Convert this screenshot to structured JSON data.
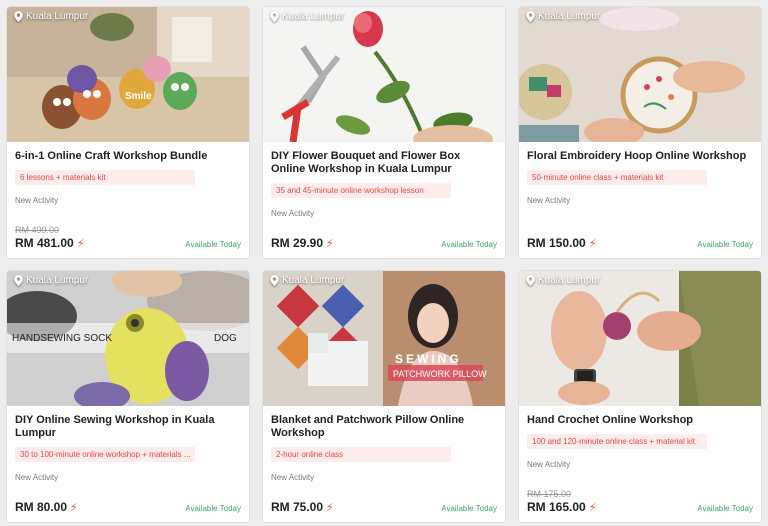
{
  "cards": [
    {
      "location": "Kuala Lumpur",
      "title": "6-in-1 Online Craft Workshop Bundle",
      "tag": "6 lessons + materials kit",
      "status": "New Activity",
      "old_price": "RM 499.00",
      "price": "RM 481.00",
      "availability": "Available Today",
      "image_text": [
        "Smile"
      ]
    },
    {
      "location": "Kuala Lumpur",
      "title": "DIY Flower Bouquet and Flower Box Online Workshop in Kuala Lumpur",
      "tag": "35 and 45-minute online workshop lesson",
      "status": "New Activity",
      "old_price": "",
      "price": "RM 29.90",
      "availability": "Available Today"
    },
    {
      "location": "Kuala Lumpur",
      "title": "Floral Embroidery Hoop Online Workshop",
      "tag": "50-minute online class + materials kit",
      "status": "New Activity",
      "old_price": "",
      "price": "RM 150.00",
      "availability": "Available Today"
    },
    {
      "location": "Kuala Lumpur",
      "title": "DIY Online Sewing Workshop in Kuala Lumpur",
      "tag": "30 to 100-minute online workshop + materials ...",
      "status": "New Activity",
      "old_price": "",
      "price": "RM 80.00",
      "availability": "Available Today",
      "image_text": [
        "HANDSEWING SOCK",
        "DOG"
      ]
    },
    {
      "location": "Kuala Lumpur",
      "title": "Blanket and Patchwork Pillow Online Workshop",
      "tag": "2-hour online class",
      "status": "New Activity",
      "old_price": "",
      "price": "RM 75.00",
      "availability": "Available Today",
      "image_text": [
        "SEWING",
        "PATCHWORK PILLOW"
      ]
    },
    {
      "location": "Kuala Lumpur",
      "title": "Hand Crochet Online Workshop",
      "tag": "100 and 120-minute online class + material kit",
      "status": "New Activity",
      "old_price": "RM 175.00",
      "price": "RM 165.00",
      "availability": "Available Today"
    }
  ],
  "icons": {
    "location": "map-pin-icon",
    "instant": "lightning-bolt-icon"
  },
  "colors": {
    "tag_bg": "#fdecec",
    "tag_text": "#e24a4a",
    "available": "#3aa76d",
    "bolt": "#ee4d2d"
  }
}
